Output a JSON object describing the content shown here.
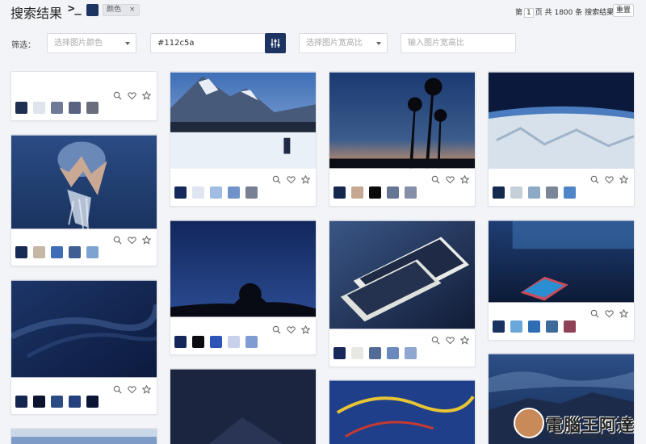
{
  "header": {
    "title": "搜索结果",
    "prompt": ">_",
    "chip_color": "#1d3462",
    "tag_label": "颜色",
    "tag_close": "×",
    "pager_prefix": "第",
    "page": "1",
    "pager_suffix": "页 共 1800 条 搜索结果",
    "reset_label": "重置"
  },
  "filters": {
    "label": "筛选：",
    "color_select_placeholder": "选择图片颜色",
    "color_value": "#112c5a",
    "ratio_select_placeholder": "选择图片宽高比",
    "ratio_input_placeholder": "输入图片宽高比"
  },
  "icons": [
    "search-icon",
    "heart-icon",
    "star-icon",
    "equalizer-icon",
    "close-icon"
  ],
  "cards": [
    {
      "swatches": [
        "#1f2f52",
        "#dfe3ec",
        "#6e7a98",
        "#5a6482",
        "#6a6e7c"
      ],
      "scene": "blank"
    },
    {
      "swatches": [
        "#172b55",
        "#c5b6a6",
        "#3f6cb7",
        "#3f5f93",
        "#7da3d1"
      ],
      "scene": "whale"
    },
    {
      "swatches": [
        "#14254f",
        "#0c1430",
        "#2d4b83",
        "#24417d",
        "#0b1535"
      ],
      "scene": "sky"
    },
    {
      "swatches": [
        "#16295a",
        "#dfe5f1",
        "#a0bce2",
        "#6f93c9",
        "#7a8093"
      ],
      "scene": "snow-mountain"
    },
    {
      "swatches": [
        "#15265a",
        "#0c0c10",
        "#2d55b8",
        "#c7d2ea",
        "#7f9dd2"
      ],
      "scene": "night-tree"
    },
    {
      "swatches": [
        "#16284e",
        "#c6a892",
        "#0b0b0b",
        "#667592",
        "#8590a8"
      ],
      "scene": "palms"
    },
    {
      "swatches": [
        "#17295a",
        "#e7e8e4",
        "#536b97",
        "#6c89bd",
        "#8ea6d0"
      ],
      "scene": "phones"
    },
    {
      "swatches": [
        "#15294f",
        "#c5cfd8",
        "#8ea9c6",
        "#7b8799",
        "#4f86c8"
      ],
      "scene": "earth"
    },
    {
      "swatches": [
        "#1a3260",
        "#6aa7da",
        "#2f6db5",
        "#3f6a9c",
        "#8e4256"
      ],
      "scene": "laptop"
    }
  ],
  "colors": {
    "accent": "#1d3462",
    "page_bg": "#f3f4f7",
    "card_border": "#e1e3e8"
  },
  "watermark": {
    "text": "電腦王阿達",
    "url": "http://www.kocpc.com.tw"
  }
}
